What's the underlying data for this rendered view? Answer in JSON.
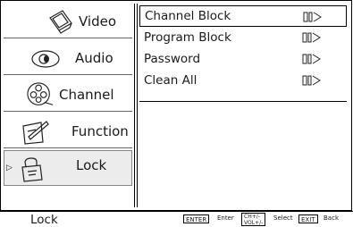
{
  "sidebar": {
    "items": [
      {
        "label": "Video",
        "icon": "tv-icon"
      },
      {
        "label": "Audio",
        "icon": "speaker-icon"
      },
      {
        "label": "Channel",
        "icon": "film-reel-icon"
      },
      {
        "label": "Function",
        "icon": "pencil-note-icon"
      },
      {
        "label": "Lock",
        "icon": "lock-icon",
        "selected": true
      }
    ]
  },
  "main": {
    "rows": [
      {
        "label": "Channel Block"
      },
      {
        "label": "Program Block"
      },
      {
        "label": "Password"
      },
      {
        "label": "Clean All"
      }
    ]
  },
  "footer": {
    "title": "Lock",
    "hints": [
      {
        "key": "ENTER",
        "action": "Enter"
      },
      {
        "key_line1": "CH+/-",
        "key_line2": "VOL+/-",
        "action": "Select"
      },
      {
        "key": "EXIT",
        "action": "Back"
      }
    ]
  }
}
